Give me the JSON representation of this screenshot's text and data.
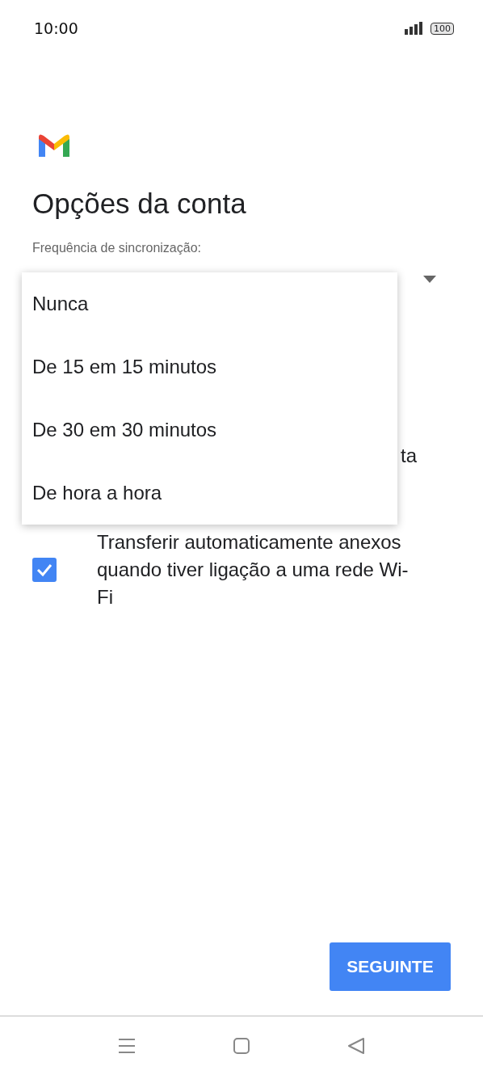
{
  "status_bar": {
    "time": "10:00",
    "battery": "100"
  },
  "title": "Opções da conta",
  "sync_frequency": {
    "label": "Frequência de sincronização:"
  },
  "hidden_row_fragment": "ta",
  "attachments_checkbox": {
    "label": "Transferir automaticamente anexos quando tiver ligação a uma rede Wi-Fi",
    "checked": true
  },
  "dropdown_menu": [
    {
      "label": "Nunca",
      "selected": false
    },
    {
      "label": "De 15 em 15 minutos",
      "selected": false
    },
    {
      "label": "De 30 em 30 minutos",
      "selected": false
    },
    {
      "label": "De hora a hora",
      "selected": false
    }
  ],
  "next_button": "SEGUINTE"
}
